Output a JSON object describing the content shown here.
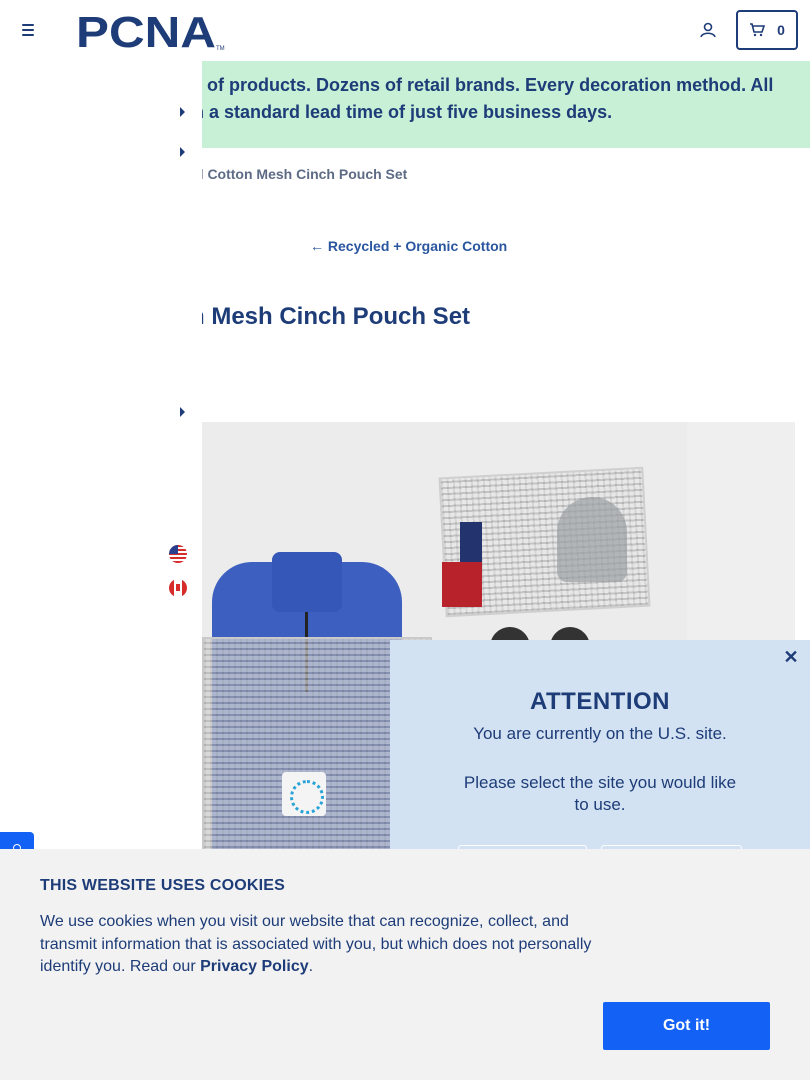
{
  "header": {
    "logo_text": "PCNA",
    "cart_count": "0"
  },
  "promo": {
    "line1": "ls of products. Dozens of retail brands. Every decoration method. All",
    "line2": "th a standard lead time of just five business days."
  },
  "breadcrumb": {
    "current": "d Cotton Mesh Cinch Pouch Set"
  },
  "back_link": {
    "arrow": "←",
    "label": "Recycled + Organic Cotton"
  },
  "product": {
    "title": "n Mesh Cinch Pouch Set"
  },
  "modal": {
    "close_glyph": "✕",
    "title": "ATTENTION",
    "line1": "You are currently on the U.S. site.",
    "line2": "Please select the site you would like to use."
  },
  "cookie": {
    "title": "THIS WEBSITE USES COOKIES",
    "text": "We use cookies when you visit our website that can recognize, collect, and transmit information that is associated with you, but which does not personally identify you. Read our ",
    "link_label": "Privacy Policy",
    "text_end": ".",
    "button_label": "Got it!"
  },
  "colors": {
    "brand_navy": "#1d3c78",
    "promo_bg": "#c8f0d6",
    "modal_bg": "#d3e2f2",
    "accent_blue": "#1462f5",
    "cookie_bg": "#f2f2f2"
  },
  "icons": {
    "menu": "hamburger-icon",
    "account": "user-icon",
    "cart": "cart-icon",
    "us_flag": "us-flag-icon",
    "ca_flag": "canada-flag-icon",
    "chat": "chat-icon"
  }
}
